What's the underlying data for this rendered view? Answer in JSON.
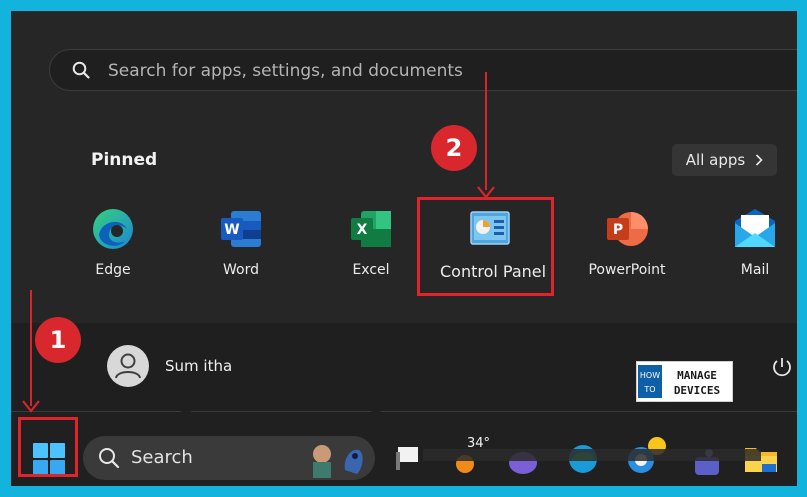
{
  "search": {
    "placeholder": "Search for apps, settings, and documents"
  },
  "pinned": {
    "title": "Pinned",
    "all_apps_label": "All apps",
    "apps": [
      {
        "label": "Edge",
        "icon": "edge-icon"
      },
      {
        "label": "Word",
        "icon": "word-icon",
        "glyph": "W"
      },
      {
        "label": "Excel",
        "icon": "excel-icon",
        "glyph": "X"
      },
      {
        "label": "Control Panel",
        "icon": "control-panel-icon"
      },
      {
        "label": "PowerPoint",
        "icon": "powerpoint-icon",
        "glyph": "P"
      },
      {
        "label": "Mail",
        "icon": "mail-icon"
      }
    ]
  },
  "user": {
    "name": "Sum itha"
  },
  "logo": {
    "line1_left": "HOW",
    "line1_right": "MANAGE",
    "line2_left": "TO",
    "line2_right": "DEVICES"
  },
  "callouts": {
    "step1": "1",
    "step2": "2"
  },
  "taskbar": {
    "search_label": "Search",
    "weather": "34°"
  },
  "colors": {
    "accent_red": "#d8282e",
    "frame_blue": "#12b4de"
  }
}
